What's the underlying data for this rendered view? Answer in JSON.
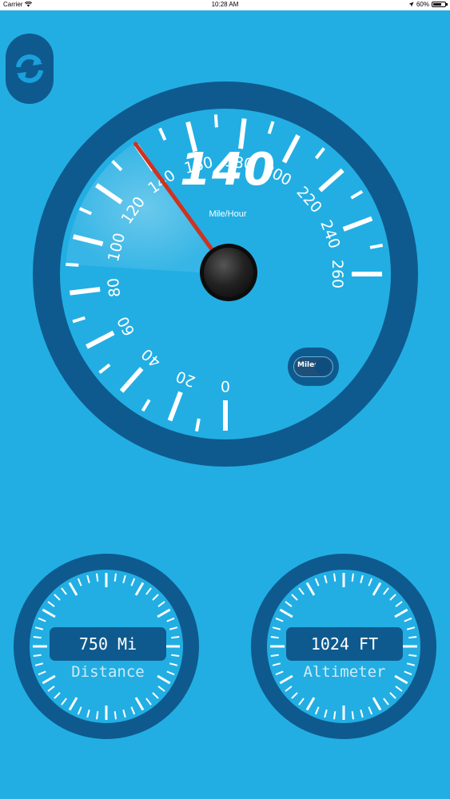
{
  "status_bar": {
    "carrier": "Carrier",
    "time": "10:28 AM",
    "battery": "60%"
  },
  "colors": {
    "background": "#22aee3",
    "gauge_ring": "#0e5a8e",
    "gauge_face": "#22aee3",
    "needle": "#d0321e",
    "tick": "#ffffff"
  },
  "speedometer": {
    "value": "140",
    "unit": "Mile/Hour",
    "needle_value": 140,
    "scale_min": 0,
    "scale_max": 260,
    "tick_labels": [
      "0",
      "20",
      "40",
      "60",
      "80",
      "100",
      "120",
      "140",
      "160",
      "180",
      "200",
      "220",
      "240",
      "260"
    ]
  },
  "unit_toggle": {
    "label": "Miles"
  },
  "distance_gauge": {
    "value": "750 Mi",
    "label": "Distance"
  },
  "altimeter_gauge": {
    "value": "1024 FT",
    "label": "Altimeter"
  }
}
